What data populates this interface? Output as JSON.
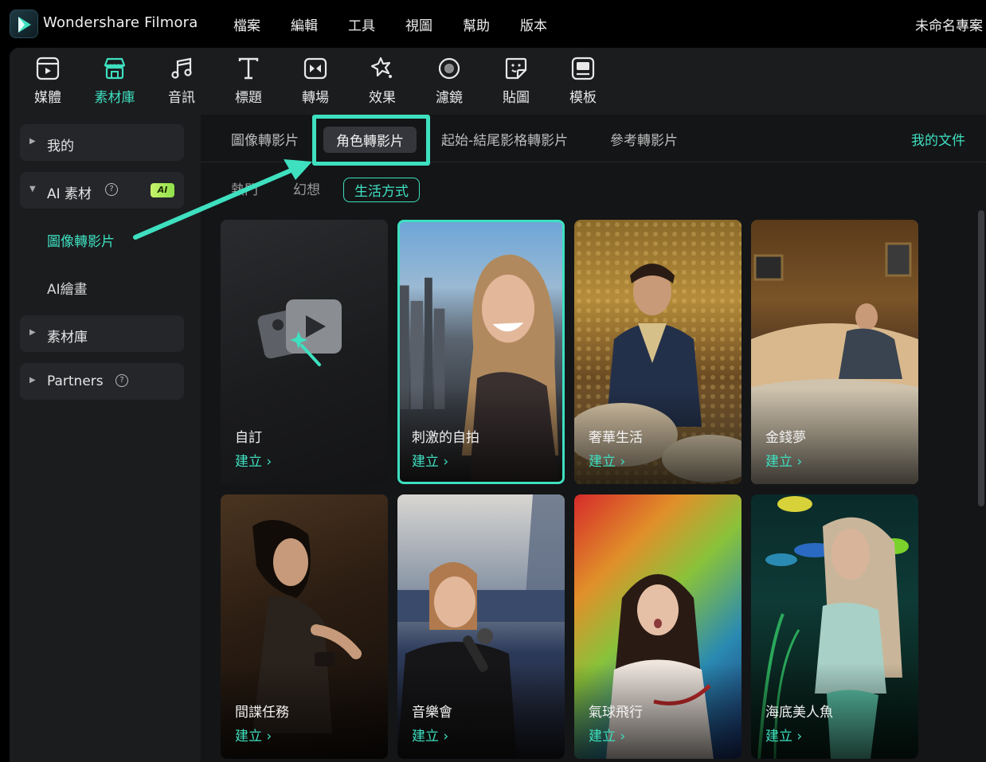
{
  "app": {
    "title": "Wondershare Filmora",
    "project_name": "未命名專案"
  },
  "menu": [
    "檔案",
    "編輯",
    "工具",
    "視圖",
    "幫助",
    "版本"
  ],
  "toolbar": [
    {
      "label": "媒體",
      "icon": "media-icon"
    },
    {
      "label": "素材庫",
      "icon": "stock-library-icon",
      "active": true
    },
    {
      "label": "音訊",
      "icon": "music-note-icon"
    },
    {
      "label": "標題",
      "icon": "title-text-icon"
    },
    {
      "label": "轉場",
      "icon": "transition-icon"
    },
    {
      "label": "效果",
      "icon": "effects-icon"
    },
    {
      "label": "濾鏡",
      "icon": "filter-icon"
    },
    {
      "label": "貼圖",
      "icon": "sticker-icon"
    },
    {
      "label": "模板",
      "icon": "template-icon"
    }
  ],
  "sidebar": {
    "mine": "我的",
    "ai_group": "AI 素材",
    "ai_badge": "AI",
    "ai_items": [
      "圖像轉影片",
      "AI繪畫"
    ],
    "library": "素材庫",
    "partners": "Partners"
  },
  "tabs": {
    "items": [
      "圖像轉影片",
      "角色轉影片",
      "起始-結尾影格轉影片",
      "參考轉影片"
    ],
    "active": "角色轉影片",
    "my_docs": "我的文件"
  },
  "chips": {
    "items": [
      "熱門",
      "幻想",
      "生活方式"
    ],
    "active": "生活方式"
  },
  "cards": [
    {
      "name": "自訂",
      "action": "建立 ›"
    },
    {
      "name": "刺激的自拍",
      "action": "建立 ›"
    },
    {
      "name": "奢華生活",
      "action": "建立 ›"
    },
    {
      "name": "金錢夢",
      "action": "建立 ›"
    },
    {
      "name": "間諜任務",
      "action": "建立 ›"
    },
    {
      "name": "音樂會",
      "action": "建立 ›"
    },
    {
      "name": "氣球飛行",
      "action": "建立 ›"
    },
    {
      "name": "海底美人魚",
      "action": "建立 ›"
    }
  ],
  "colors": {
    "accent": "#3ee0c0",
    "panel": "#1b1c1e",
    "background": "#141517"
  }
}
